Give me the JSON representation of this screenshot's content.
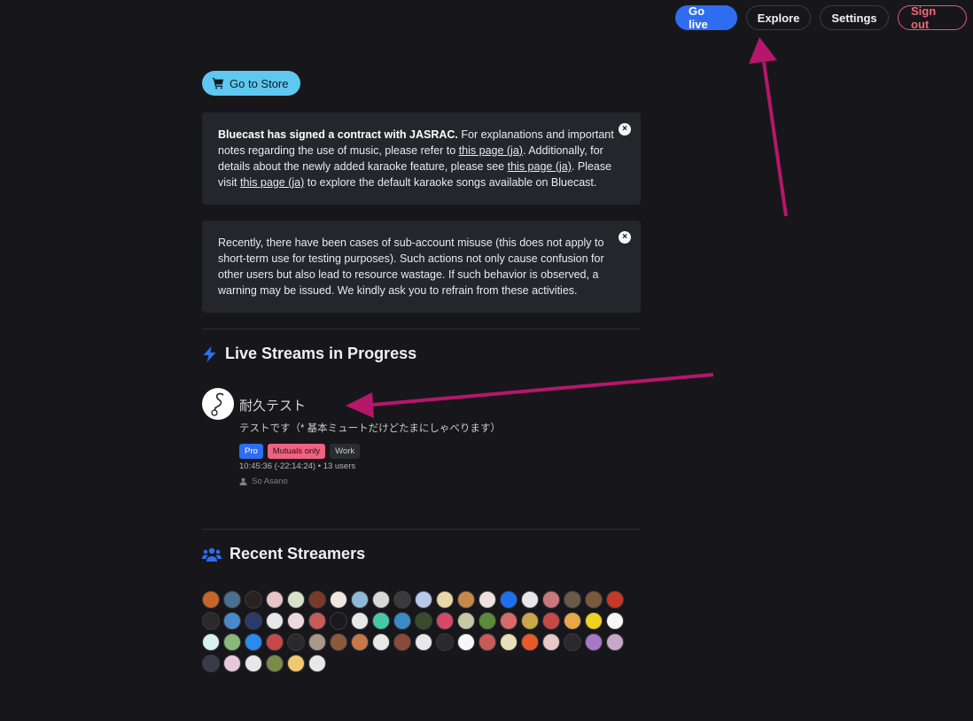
{
  "nav": {
    "go_live": "Go live",
    "explore": "Explore",
    "settings": "Settings",
    "sign_out": "Sign out"
  },
  "store_button": "Go to Store",
  "notice1": {
    "bold": "Bluecast has signed a contract with JASRAC.",
    "t1": " For explanations and important notes regarding the use of music, please refer to ",
    "link1": "this page (ja)",
    "t2": ". Additionally, for details about the newly added karaoke feature, please see ",
    "link2": "this page (ja)",
    "t3": ". Please visit ",
    "link3": "this page (ja)",
    "t4": " to explore the default karaoke songs available on Bluecast."
  },
  "notice2": {
    "text": "Recently, there have been cases of sub-account misuse (this does not apply to short-term use for testing purposes). Such actions not only cause confusion for other users but also lead to resource wastage. If such behavior is observed, a warning may be issued. We kindly ask you to refrain from these activities."
  },
  "close_glyph": "×",
  "live_section": {
    "title": "Live Streams in Progress"
  },
  "stream": {
    "title": "耐久テスト",
    "description": "テストです（* 基本ミュートだけどたまにしゃべります）",
    "tags": {
      "pro": "Pro",
      "mutual": "Mutuals only",
      "work": "Work"
    },
    "meta": "10:45:36 (-22:14:24) • 13 users",
    "user": "So Asano"
  },
  "recent_section": {
    "title": "Recent Streamers"
  },
  "recent_streamers_colors": [
    "#c8652a",
    "#4a6f8f",
    "#2a2220",
    "#e8c3c8",
    "#d9e2c9",
    "#7a3a2a",
    "#f0e8e0",
    "#8fb8d8",
    "#d8d8d8",
    "#3a3a3a",
    "#b8c8e8",
    "#e8d8a8",
    "#c88848",
    "#f0e0e0",
    "#1e6ff0",
    "#e8e8e8",
    "#c87878",
    "#6a5a48",
    "#7a5a3a",
    "#c83828",
    "#2a2a2a",
    "#4a8ac8",
    "#2a3a6a",
    "#e8e8e8",
    "#f0d8e0",
    "#c85a5a",
    "#1a1a1a",
    "#e8e8e8",
    "#48c8a8",
    "#3a8ac8",
    "#3a4a2a",
    "#d84868",
    "#c8c8a8",
    "#5a8a3a",
    "#d86a6a",
    "#c8a848",
    "#c84848",
    "#e8a848",
    "#f0d020",
    "#f8f8f8",
    "#d8f0f0",
    "#8ab87a",
    "#2a8af0",
    "#c84848",
    "#2a2a2a",
    "#a89888",
    "#8a5a3a",
    "#c87848",
    "#e8e8e8",
    "#8a4a3a",
    "#e8e8e8",
    "#2a2a2a",
    "#f8f8f8",
    "#c85a5a",
    "#e8e0b8",
    "#e85a28",
    "#e8c8c8",
    "#2a2a2a",
    "#a878c8",
    "#c8a8c8",
    "#3a3a4a",
    "#e8c8d8",
    "#e8e8e8",
    "#7a8a4a",
    "#f0c870",
    "#e8e8e8"
  ]
}
